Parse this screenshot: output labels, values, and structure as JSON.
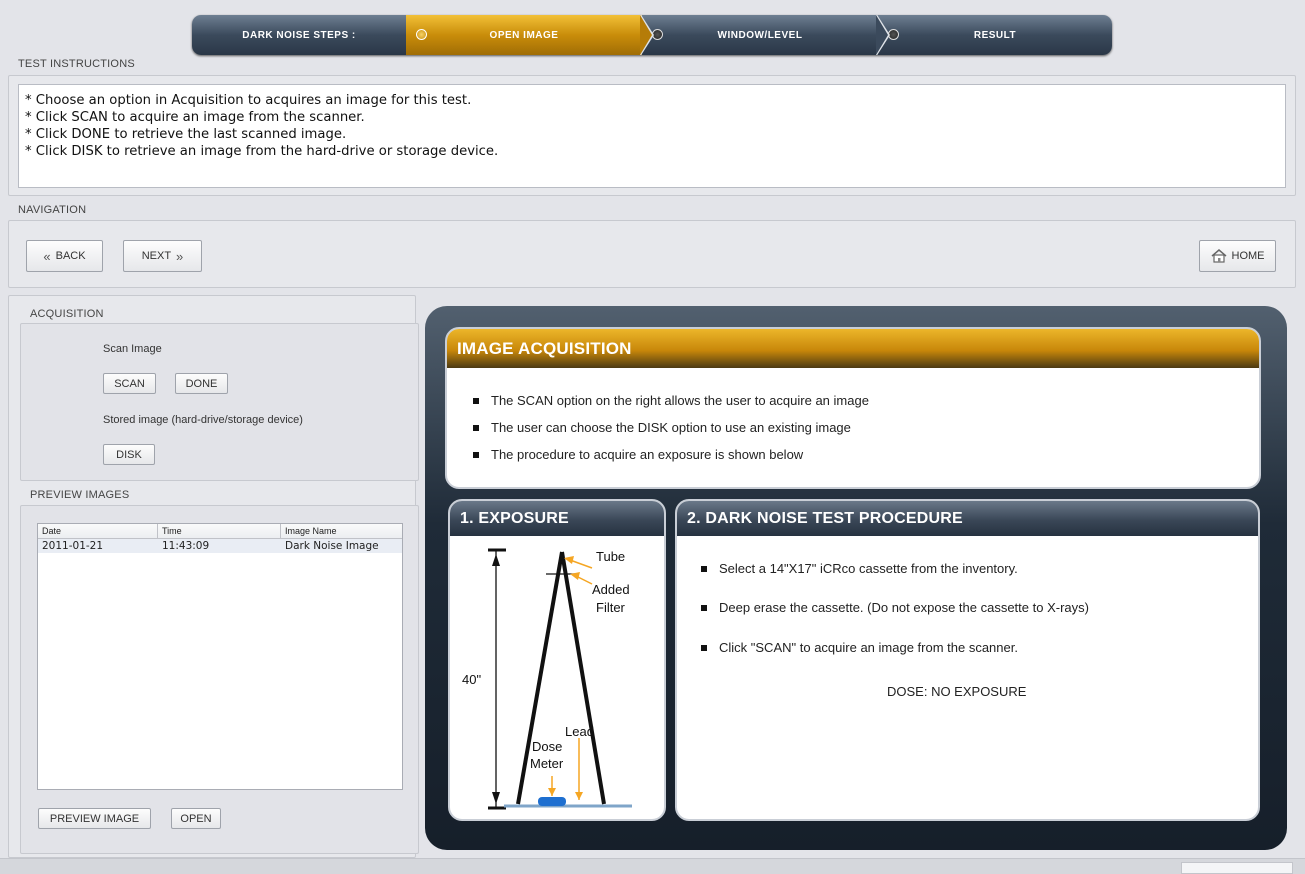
{
  "steps": {
    "title": "DARK NOISE STEPS :",
    "items": [
      {
        "label": "OPEN IMAGE",
        "active": true
      },
      {
        "label": "WINDOW/LEVEL",
        "active": false
      },
      {
        "label": "RESULT",
        "active": false
      }
    ]
  },
  "test_instructions": {
    "label": "TEST INSTRUCTIONS",
    "lines": [
      "* Choose an option in Acquisition to acquires an image for this test.",
      "* Click SCAN to acquire an image from the scanner.",
      "* Click DONE to retrieve the last scanned image.",
      "* Click DISK to retrieve an image from the hard-drive or storage device."
    ]
  },
  "navigation": {
    "label": "NAVIGATION",
    "back": "BACK",
    "next": "NEXT",
    "home": "HOME"
  },
  "acquisition": {
    "label": "ACQUISITION",
    "scan_image": "Scan Image",
    "scan": "SCAN",
    "done": "DONE",
    "stored_image": "Stored image (hard-drive/storage device)",
    "disk": "DISK"
  },
  "previous_images": {
    "label": "PREVIEW IMAGES",
    "columns": [
      "Date",
      "Time",
      "Image Name"
    ],
    "rows": [
      {
        "date": "2011-01-21",
        "time": "11:43:09",
        "name": "Dark Noise Image"
      }
    ],
    "preview_button": "PREVIEW IMAGE",
    "open_button": "OPEN"
  },
  "image_acquisition": {
    "title": "IMAGE ACQUISITION",
    "bullets": [
      "The SCAN option on the right allows the user to acquire an image",
      "The user can choose the DISK option to use an existing image",
      "The procedure to acquire an exposure is shown below"
    ]
  },
  "exposure": {
    "title": "1. EXPOSURE",
    "labels": {
      "tube": "Tube",
      "added": "Added",
      "filter": "Filter",
      "distance": "40\"",
      "lead": "Lead",
      "dose": "Dose",
      "meter": "Meter"
    }
  },
  "procedure": {
    "title": "2. DARK NOISE TEST PROCEDURE",
    "bullets": [
      "Select a 14\"X17\" iCRco cassette from the inventory.",
      "Deep erase the cassette. (Do not expose the cassette to X-rays)",
      "Click \"SCAN\" to acquire an image from the scanner."
    ],
    "dose": "DOSE: NO EXPOSURE"
  },
  "colors": {
    "accent_gold": "#c98d0a",
    "dark_slate": "#2a3747",
    "beam_orange": "#f5a623",
    "meter_blue": "#1e6fd0"
  }
}
